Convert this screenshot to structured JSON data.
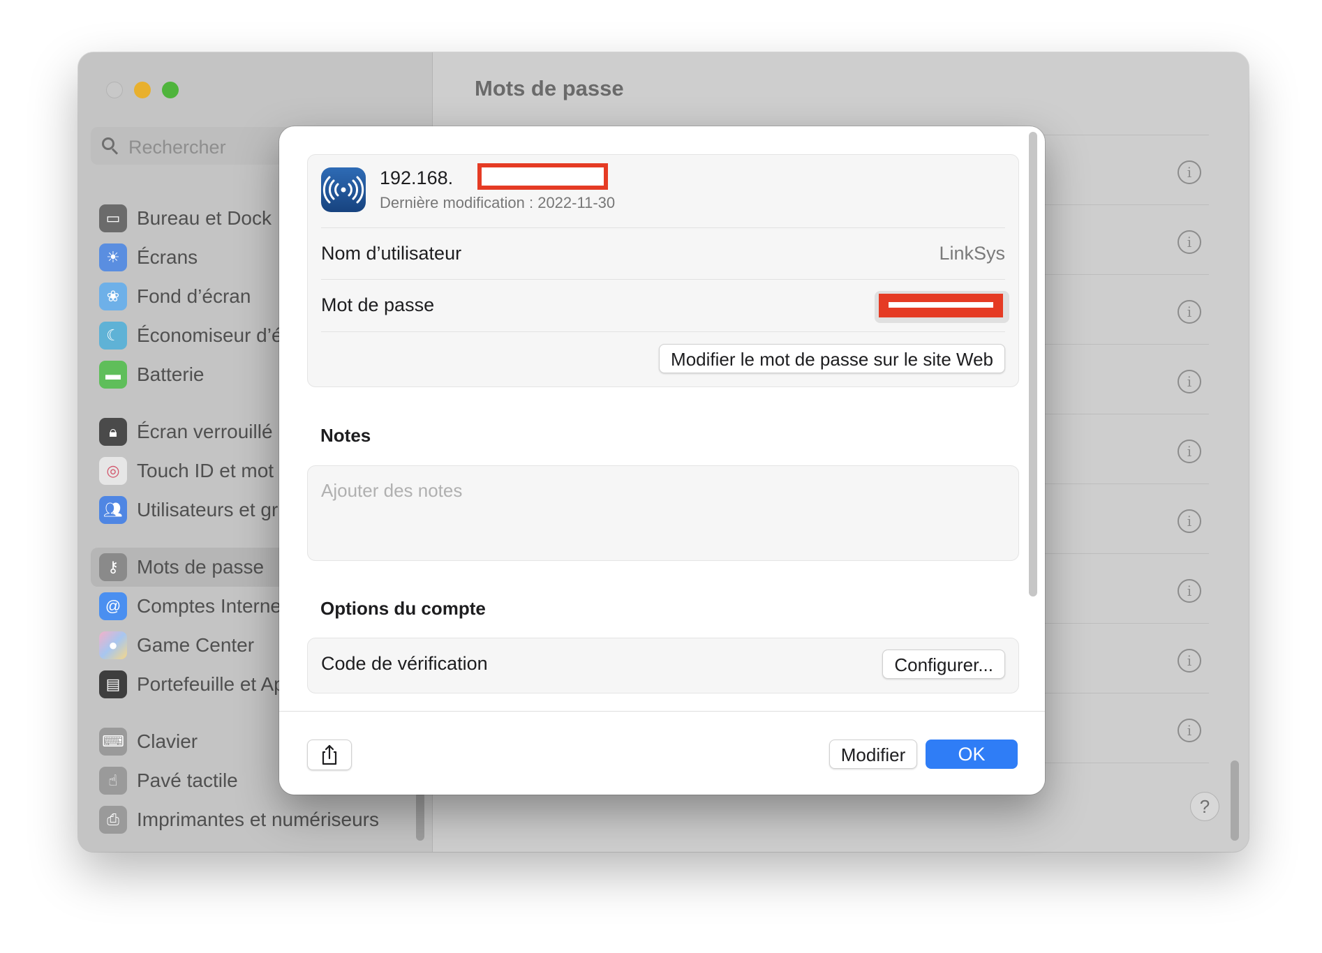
{
  "window": {
    "title": "Mots de passe"
  },
  "search": {
    "placeholder": "Rechercher"
  },
  "sidebar": {
    "items": [
      {
        "label": "Bureau et Dock",
        "icon": "dock-icon",
        "color": "#6b6b6b"
      },
      {
        "label": "Écrans",
        "icon": "sun-icon",
        "color": "#5a8ee0"
      },
      {
        "label": "Fond d’écran",
        "icon": "flower-icon",
        "color": "#6eb0e8"
      },
      {
        "label": "Économiseur d’éc",
        "icon": "screensaver-icon",
        "color": "#5fb2d6"
      },
      {
        "label": "Batterie",
        "icon": "battery-icon",
        "color": "#5fbe5a"
      },
      {
        "label": "Écran verrouillé",
        "icon": "lock-icon",
        "color": "#4a4a4a"
      },
      {
        "label": "Touch ID et mot d",
        "icon": "fingerprint-icon",
        "color": "#e0e0e0"
      },
      {
        "label": "Utilisateurs et gr",
        "icon": "users-icon",
        "color": "#4f86e3"
      },
      {
        "label": "Mots de passe",
        "icon": "key-icon",
        "color": "#8a8a8a",
        "selected": true
      },
      {
        "label": "Comptes Interne",
        "icon": "at-icon",
        "color": "#4a8ff0"
      },
      {
        "label": "Game Center",
        "icon": "game-center-icon",
        "color": "#d9a0c0"
      },
      {
        "label": "Portefeuille et Ap",
        "icon": "wallet-icon",
        "color": "#3e3e3e"
      },
      {
        "label": "Clavier",
        "icon": "keyboard-icon",
        "color": "#9a9a9a"
      },
      {
        "label": "Pavé tactile",
        "icon": "trackpad-icon",
        "color": "#9a9a9a"
      },
      {
        "label": "Imprimantes et numériseurs",
        "icon": "printer-icon",
        "color": "#9a9a9a"
      }
    ]
  },
  "dialog": {
    "host_prefix": "192.168.",
    "last_modified": "Dernière modification : 2022-11-30",
    "username_label": "Nom d’utilisateur",
    "username_value": "LinkSys",
    "password_label": "Mot de passe",
    "change_password_button": "Modifier le mot de passe sur le site Web",
    "notes_title": "Notes",
    "notes_placeholder": "Ajouter des notes",
    "account_options_title": "Options du compte",
    "verification_code_label": "Code de vérification",
    "configure_button": "Configurer...",
    "edit_button": "Modifier",
    "ok_button": "OK",
    "accent_color": "#2f7df6",
    "redaction_color": "#e53b24"
  },
  "help": {
    "label": "?"
  }
}
